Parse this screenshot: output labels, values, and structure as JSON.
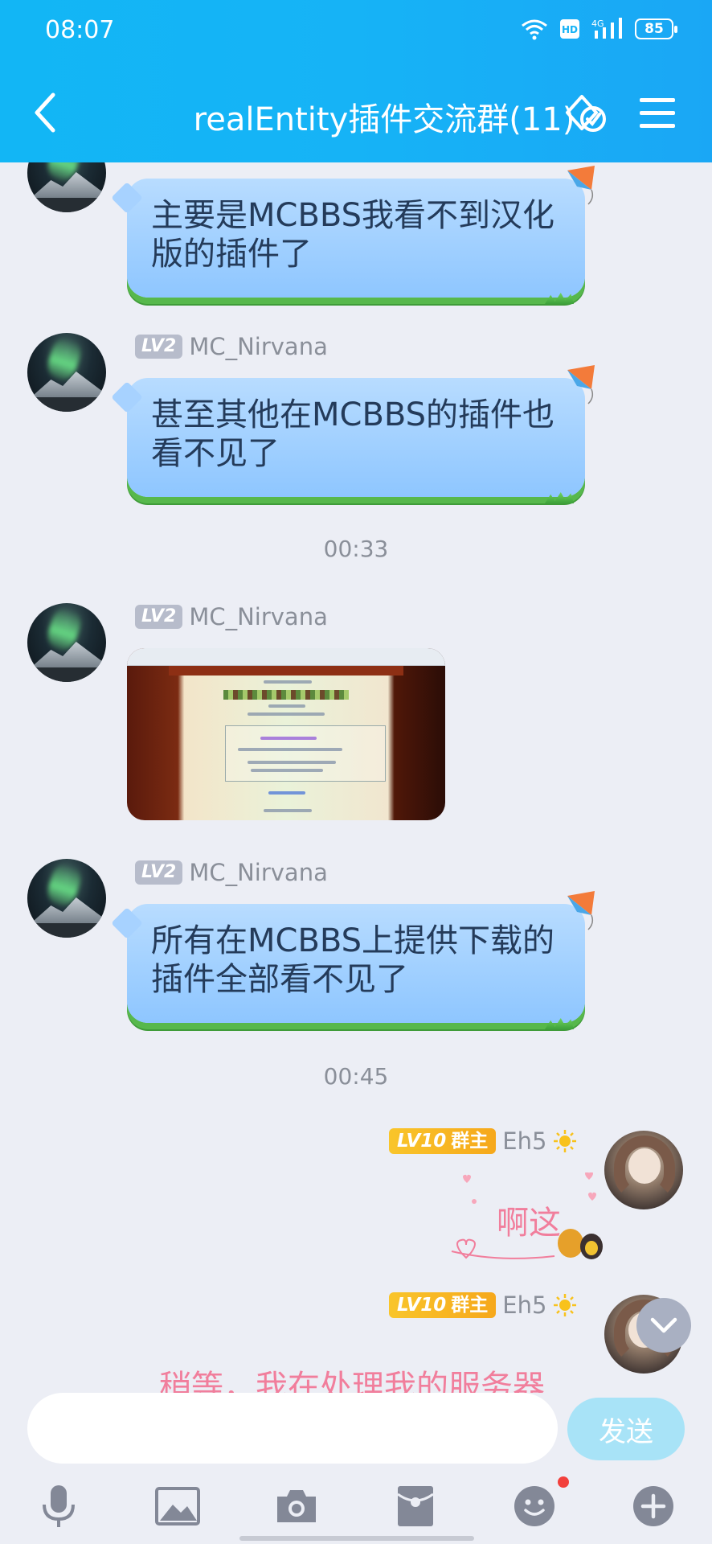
{
  "status_bar": {
    "time": "08:07",
    "network": "4G",
    "battery": "85"
  },
  "header": {
    "title": "realEntity插件交流群(11)"
  },
  "messages": [
    {
      "text": "主要是MCBBS我看不到汉化版的插件了"
    },
    {
      "sender": "MC_Nirvana",
      "level": "LV2",
      "text": "甚至其他在MCBBS的插件也看不见了"
    },
    {
      "time": "00:33"
    },
    {
      "sender": "MC_Nirvana",
      "level": "LV2",
      "type": "image"
    },
    {
      "sender": "MC_Nirvana",
      "level": "LV2",
      "text": "所有在MCBBS上提供下载的插件全部看不见了"
    },
    {
      "time": "00:45"
    },
    {
      "sender": "Eh5",
      "level": "LV10",
      "role": "群主",
      "sticker_text": "啊这"
    },
    {
      "sender": "Eh5",
      "level": "LV10",
      "role": "群主",
      "partial_text": "稍等，我在处理我的服务器"
    }
  ],
  "input": {
    "placeholder": "",
    "send_label": "发送"
  },
  "toolbar": [
    "mic-icon",
    "image-icon",
    "camera-icon",
    "red-packet-icon",
    "emoji-icon",
    "plus-icon"
  ],
  "colors": {
    "header": "#16b3f6",
    "bubble": "#a7d2ff",
    "bubble_grass": "#57b84c",
    "background": "#eceef5",
    "send": "#a8e3f7",
    "level_gold": "#f9c52b"
  }
}
